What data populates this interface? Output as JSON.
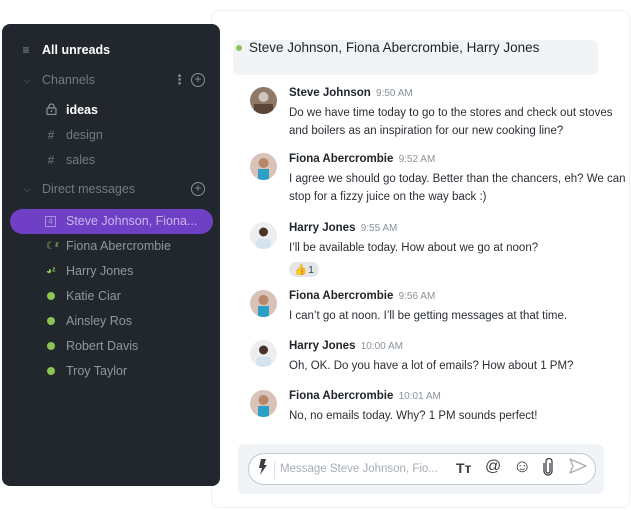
{
  "sidebar": {
    "all_unreads": {
      "label": "All unreads",
      "icon": "list-icon"
    },
    "channels_section": {
      "label": "Channels",
      "icon": "chevron-down-icon"
    },
    "channels": [
      {
        "label": "ideas",
        "icon": "lock-icon",
        "active": true
      },
      {
        "label": "design",
        "icon": "hash-icon",
        "active": false
      },
      {
        "label": "sales",
        "icon": "hash-icon",
        "active": false
      }
    ],
    "dm_section": {
      "label": "Direct messages",
      "icon": "chevron-down-icon"
    },
    "direct_messages": [
      {
        "label": "Steve Johnson, Fiona...",
        "status": "group",
        "badge": "4",
        "selected": true
      },
      {
        "label": "Fiona Abercrombie",
        "status": "away"
      },
      {
        "label": "Harry Jones",
        "status": "busy"
      },
      {
        "label": "Katie Ciar",
        "status": "online"
      },
      {
        "label": "Ainsley Ros",
        "status": "online"
      },
      {
        "label": "Robert Davis",
        "status": "online"
      },
      {
        "label": "Troy Taylor",
        "status": "online"
      }
    ],
    "glyphs": {
      "list": "≡",
      "chevron": "⌄",
      "lock": "🔒",
      "hash": "#",
      "add": "+",
      "more": "⋮",
      "away": "☾ᶻ",
      "busy": "◕ᶻ"
    }
  },
  "chat": {
    "title": "Steve Johnson, Fiona Abercrombie, Harry Jones",
    "online_color": "#8ac452",
    "messages": [
      {
        "author": "Steve Johnson",
        "time": "9:50 AM",
        "text": "Do we have time today to go to the stores and check out stoves and boilers as an inspiration for our new cooking line?"
      },
      {
        "author": "Fiona Abercrombie",
        "time": "9:52 AM",
        "text": "I agree we should go today. Better than the chancers, eh? We can stop for a fizzy juice on the way back :)"
      },
      {
        "author": "Harry Jones",
        "time": "9:55 AM",
        "text": "I’ll be available today. How about we go at noon?",
        "reaction": {
          "emoji": "👍",
          "count": "1"
        }
      },
      {
        "author": "Fiona Abercrombie",
        "time": "9:56 AM",
        "text": "I can’t go at noon. I’ll be getting messages at that time."
      },
      {
        "author": "Harry Jones",
        "time": "10:00 AM",
        "text": "Oh, OK. Do you have a lot of emails? How about 1 PM?"
      },
      {
        "author": "Fiona Abercrombie",
        "time": "10:01 AM",
        "text": "No, no emails today. Why? 1 PM sounds perfect!"
      }
    ]
  },
  "composer": {
    "placeholder": "Message Steve Johnson, Fio...",
    "value": "",
    "tools": {
      "format": "Tт",
      "mention": "@",
      "emoji": "☺",
      "attach": "📎",
      "send": "➤",
      "bolt": "ϟ"
    }
  },
  "colors": {
    "accent": "#6f3fc5",
    "sidebar_bg": "#21272d",
    "online": "#8ac452"
  }
}
